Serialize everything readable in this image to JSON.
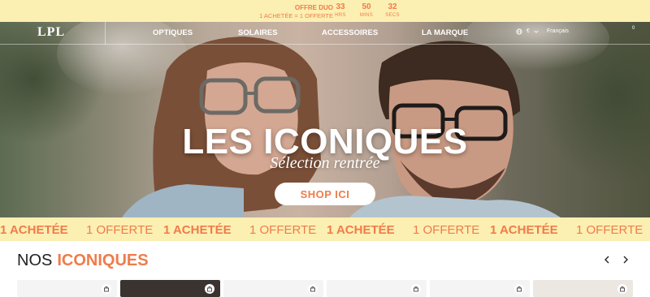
{
  "promo": {
    "title": "OFFRE DUO",
    "subtitle": "1 ACHETÉE = 1 OFFERTE",
    "countdown": [
      {
        "value": "33",
        "unit": "HRS"
      },
      {
        "value": "50",
        "unit": "MINS"
      },
      {
        "value": "32",
        "unit": "SECS"
      }
    ]
  },
  "header": {
    "logo": "LPL",
    "nav": [
      "OPTIQUES",
      "SOLAIRES",
      "ACCESSOIRES",
      "LA MARQUE"
    ],
    "currency": "€",
    "language": "Français",
    "cart_count": "0"
  },
  "hero": {
    "title": "LES ICONIQUES",
    "subtitle": "Sélection rentrée",
    "cta": "SHOP ICI"
  },
  "marquee": {
    "items": [
      "1 ACHETÉE",
      "1 OFFERTE",
      "1 ACHETÉE",
      "1 OFFERTE",
      "1 ACHETÉE",
      "1 OFFERTE",
      "1 ACHETÉE",
      "1 OFFERTE"
    ]
  },
  "section": {
    "title_plain": "NOS",
    "title_accent": "ICONIQUES"
  },
  "colors": {
    "accent": "#ef7c4a",
    "promo_bg": "#fcefb2"
  },
  "icons": [
    "globe-icon",
    "chevron-down-icon",
    "cart-icon",
    "arrow-left-icon",
    "arrow-right-icon",
    "bag-icon"
  ]
}
